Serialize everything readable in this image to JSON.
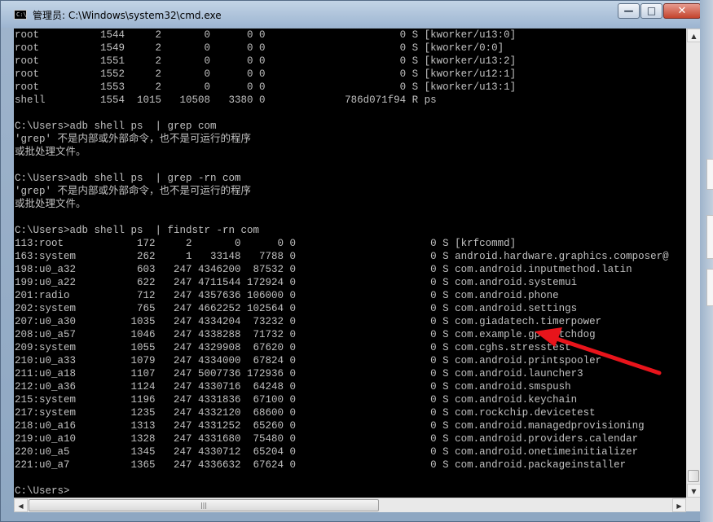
{
  "window": {
    "title": "管理员: C:\\Windows\\system32\\cmd.exe",
    "icon_text": "C:\\",
    "minimize_glyph": "—",
    "maximize_glyph": "□",
    "close_glyph": "✕"
  },
  "console": {
    "lines": [
      "root          1544     2       0      0 0                      0 S [kworker/u13:0]",
      "root          1549     2       0      0 0                      0 S [kworker/0:0]",
      "root          1551     2       0      0 0                      0 S [kworker/u13:2]",
      "root          1552     2       0      0 0                      0 S [kworker/u12:1]",
      "root          1553     2       0      0 0                      0 S [kworker/u13:1]",
      "shell         1554  1015   10508   3380 0             786d071f94 R ps",
      "",
      "C:\\Users>adb shell ps  | grep com",
      "'grep' 不是内部或外部命令，也不是可运行的程序",
      "或批处理文件。",
      "",
      "C:\\Users>adb shell ps  | grep -rn com",
      "'grep' 不是内部或外部命令，也不是可运行的程序",
      "或批处理文件。",
      "",
      "C:\\Users>adb shell ps  | findstr -rn com",
      "113:root            172     2       0      0 0                      0 S [krfcommd]",
      "163:system          262     1   33148   7788 0                      0 S android.hardware.graphics.composer@",
      "198:u0_a32          603   247 4346200  87532 0                      0 S com.android.inputmethod.latin",
      "199:u0_a22          622   247 4711544 172924 0                      0 S com.android.systemui",
      "201:radio           712   247 4357636 106000 0                      0 S com.android.phone",
      "202:system          765   247 4662252 102564 0                      0 S com.android.settings",
      "207:u0_a30         1035   247 4334204  73232 0                      0 S com.giadatech.timerpower",
      "208:u0_a57         1046   247 4338288  71732 0                      0 S com.example.gpswatchdog",
      "209:system         1055   247 4329908  67620 0                      0 S com.cghs.stresstest",
      "210:u0_a33         1079   247 4334000  67824 0                      0 S com.android.printspooler",
      "211:u0_a18         1107   247 5007736 172936 0                      0 S com.android.launcher3",
      "212:u0_a36         1124   247 4330716  64248 0                      0 S com.android.smspush",
      "215:system         1196   247 4331836  67100 0                      0 S com.android.keychain",
      "217:system         1235   247 4332120  68600 0                      0 S com.rockchip.devicetest",
      "218:u0_a16         1313   247 4331252  65260 0                      0 S com.android.managedprovisioning",
      "219:u0_a10         1328   247 4331680  75480 0                      0 S com.android.providers.calendar",
      "220:u0_a5          1345   247 4330712  65204 0                      0 S com.android.onetimeinitializer",
      "221:u0_a7          1365   247 4336632  67624 0                      0 S com.android.packageinstaller",
      "",
      "C:\\Users>"
    ]
  },
  "scrollbar": {
    "up_glyph": "▲",
    "down_glyph": "▼",
    "left_glyph": "◀",
    "right_glyph": "▶",
    "thumb_grip": "|||"
  },
  "colors": {
    "console_bg": "#000000",
    "console_fg": "#c0c0c0",
    "annotation_arrow": "#e8141b"
  }
}
